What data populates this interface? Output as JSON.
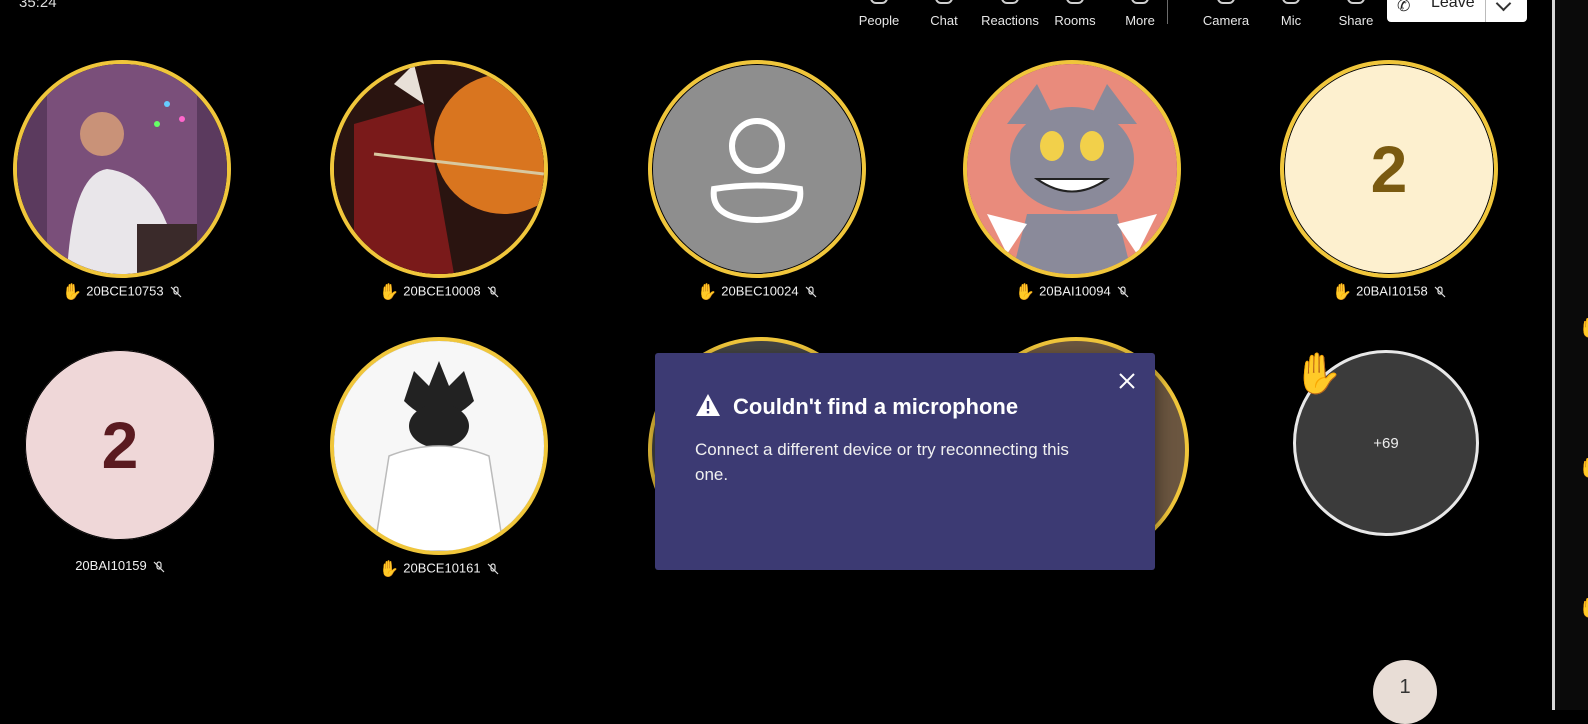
{
  "meeting": {
    "timer": "35:24"
  },
  "toolbar": {
    "people": "People",
    "chat": "Chat",
    "reactions": "Reactions",
    "rooms": "Rooms",
    "more": "More",
    "camera": "Camera",
    "mic": "Mic",
    "share": "Share",
    "leave": "Leave"
  },
  "participants": [
    {
      "name": "20BCE10753",
      "hand_raised": true,
      "muted": true,
      "avatar": "photo-person-lit"
    },
    {
      "name": "20BCE10008",
      "hand_raised": true,
      "muted": true,
      "avatar": "samurai-art"
    },
    {
      "name": "20BEC10024",
      "hand_raised": true,
      "muted": true,
      "avatar": "default-person-icon"
    },
    {
      "name": "20BAI10094",
      "hand_raised": true,
      "muted": true,
      "avatar": "cartoon-cat"
    },
    {
      "name": "20BAI10158",
      "hand_raised": true,
      "muted": true,
      "avatar": "initial",
      "initial": "2",
      "bg": "#fdf0cf",
      "fg": "#7a5a10"
    },
    {
      "name": "20BAI10159",
      "hand_raised": false,
      "muted": true,
      "avatar": "initial",
      "initial": "2",
      "bg": "#efd7d8",
      "fg": "#5a1a20"
    },
    {
      "name": "20BCE10161",
      "hand_raised": true,
      "muted": true,
      "avatar": "anime-character"
    }
  ],
  "overflow": {
    "count": "+69"
  },
  "dialog": {
    "title": "Couldn't find a microphone",
    "body": "Connect a different device or try reconnecting this one."
  },
  "pager": {
    "current": "1"
  },
  "colors": {
    "ring": "#f0c63b",
    "dialog_bg": "#3c3a73",
    "hand": "#f4b400"
  }
}
